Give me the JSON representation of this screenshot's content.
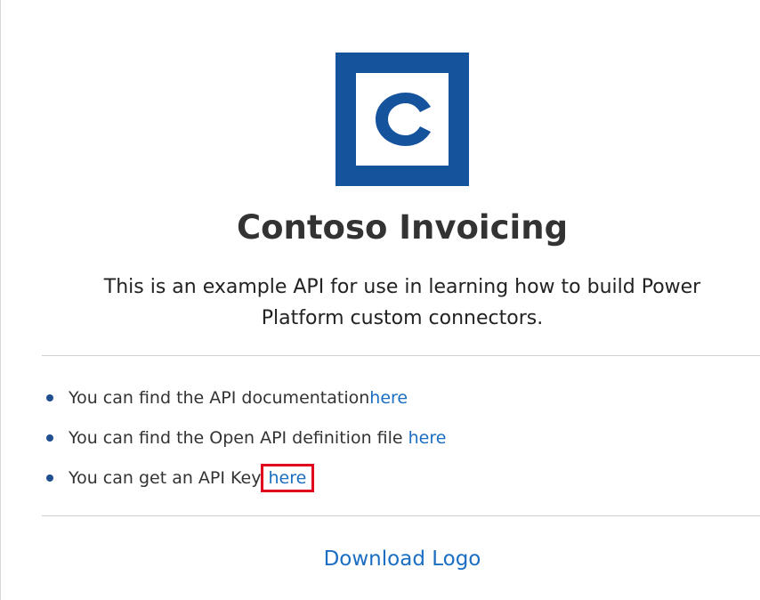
{
  "logo": {
    "icon": "letter-c-logo",
    "letter": "C",
    "colors": {
      "frame": "#16539d",
      "inner": "#ffffff",
      "letter": "#16539d"
    }
  },
  "title": "Contoso Invoicing",
  "description": "This is an example API for use in learning how to build Power Platform custom connectors.",
  "links": [
    {
      "text": "You can find the API documentation",
      "link_text": "here"
    },
    {
      "text": "You can find the Open API definition file ",
      "link_text": "here"
    },
    {
      "text": "You can get an API Key ",
      "link_text": "here"
    }
  ],
  "download_label": "Download Logo",
  "colors": {
    "link": "#1b6ec2",
    "highlight": "#e0001b",
    "text": "#333333"
  }
}
